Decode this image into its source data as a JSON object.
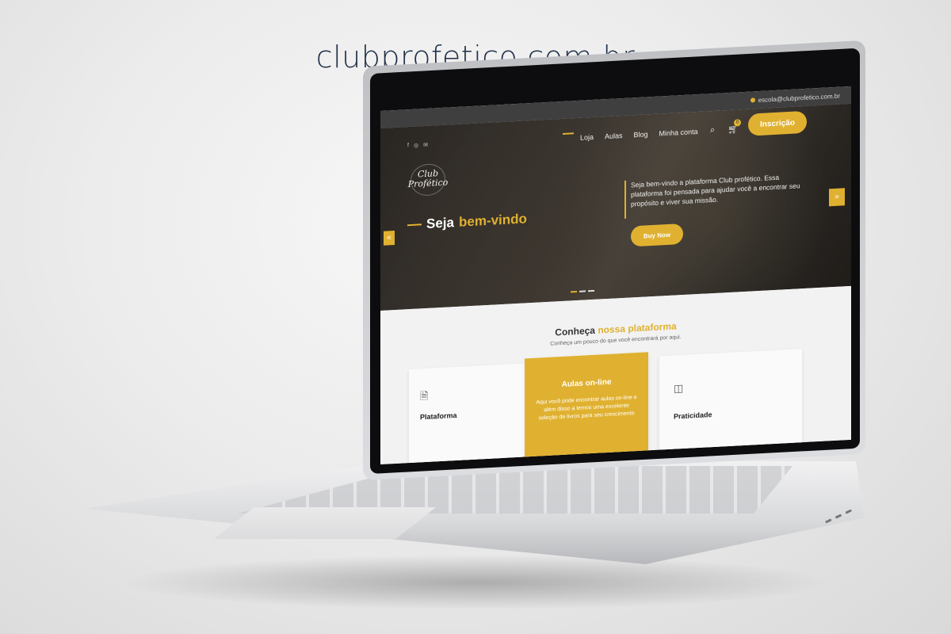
{
  "page": {
    "title": "clubprofetico.com.br"
  },
  "topbar": {
    "email": "escola@clubprofetico.com.br"
  },
  "nav": {
    "social_icons": [
      "facebook-icon",
      "instagram-icon",
      "mail-icon"
    ],
    "menu": [
      "Loja",
      "Aulas",
      "Blog",
      "Minha conta"
    ],
    "cart_count": "0",
    "cta_label": "Inscrição"
  },
  "logo": {
    "line1": "Club",
    "line2": "Profético"
  },
  "hero": {
    "headline_part1": "Seja",
    "headline_part2": "bem-vindo",
    "intro": "Seja bem-vindo a plataforma Club profético. Essa plataforma foi pensada para ajudar você a encontrar seu propósito e viver sua missão.",
    "button_label": "Buy Now",
    "slides": 3,
    "active_slide": 1
  },
  "section": {
    "title_part1": "Conheça",
    "title_part2": "nossa plataforma",
    "subtitle": "Conheça um pouco do que você encontrará por aqui.",
    "cards": [
      {
        "label": "Plataforma",
        "icon": "document-icon"
      },
      {
        "label": "Aulas on-line",
        "text": "Aqui você pode encontrar aulas on-line e além disso a temos uma excelente seleção de livros para seu crescimento"
      },
      {
        "label": "Praticidade",
        "icon": "layout-icon"
      }
    ]
  },
  "colors": {
    "accent": "#e0b130",
    "title": "#1f3048"
  }
}
